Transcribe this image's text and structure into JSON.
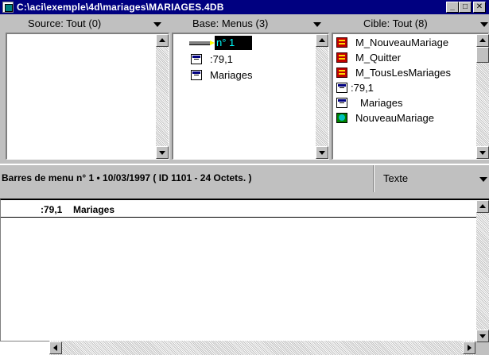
{
  "window": {
    "title": "C:\\aci\\exemple\\4d\\mariages\\MARIAGES.4DB",
    "minimize": "_",
    "maximize": "□",
    "close": "✕"
  },
  "panes": {
    "source": {
      "label": "Source: Tout (0)",
      "items": []
    },
    "base": {
      "label": "Base: Menus (3)",
      "items": [
        {
          "icon": "menu-bar-icon",
          "text": "n° 1",
          "selected": true
        },
        {
          "icon": "menu-icon",
          "text": ":79,1"
        },
        {
          "icon": "menu-icon",
          "text": "Mariages"
        }
      ]
    },
    "cible": {
      "label": "Cible: Tout (8)",
      "items": [
        {
          "icon": "method-icon",
          "text": "M_NouveauMariage"
        },
        {
          "icon": "method-icon",
          "text": "M_Quitter"
        },
        {
          "icon": "method-icon",
          "text": "M_TousLesMariages"
        },
        {
          "icon": "menu-icon",
          "text": ":79,1"
        },
        {
          "icon": "menu-icon",
          "text": "Mariages"
        },
        {
          "icon": "form-icon",
          "text": "NouveauMariage"
        }
      ]
    }
  },
  "infobar": {
    "info": "Barres de menu n° 1 • 10/03/1997 ( ID 1101 - 24 Octets. )",
    "type": "Texte"
  },
  "editor": {
    "number": ":79,1",
    "name": "Mariages"
  },
  "colors": {
    "titlebar": "#000080",
    "selection_bg": "#000000",
    "selection_text": "#00ffff"
  }
}
